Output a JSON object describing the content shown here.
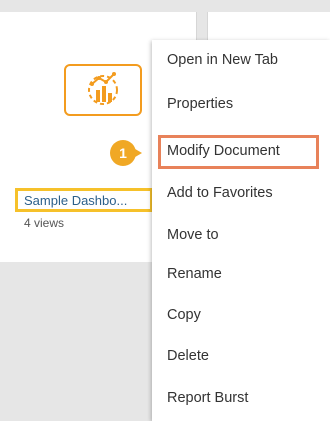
{
  "card": {
    "title": "Sample Dashbo...",
    "views": "4 views",
    "thumbnail_icon": "dashboard-chart-icon",
    "accent_color": "#f39c1f"
  },
  "callout": {
    "number": "1",
    "color": "#f0a825"
  },
  "context_menu": {
    "items": [
      {
        "label": "Open in New Tab"
      },
      {
        "label": "Properties"
      },
      {
        "label": "Modify Document"
      },
      {
        "label": "Add to Favorites"
      },
      {
        "label": "Move to"
      },
      {
        "label": "Rename"
      },
      {
        "label": "Copy"
      },
      {
        "label": "Delete"
      },
      {
        "label": "Report Burst"
      }
    ],
    "highlight_color": "#e8825a"
  }
}
